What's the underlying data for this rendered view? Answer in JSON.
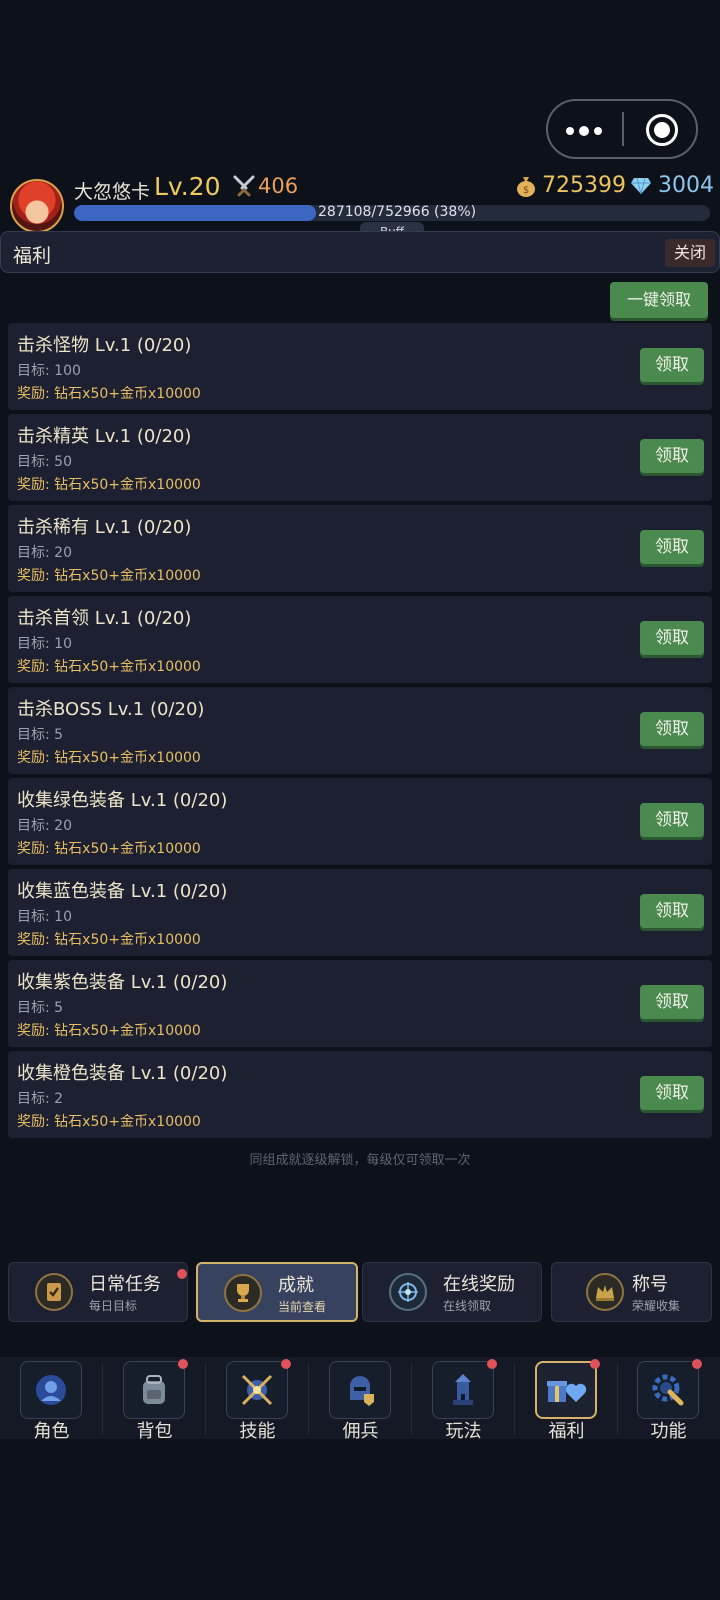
{
  "capsule": {
    "more_icon": "more-dots-icon",
    "record_icon": "record-icon"
  },
  "player": {
    "name": "大忽悠卡",
    "level": "Lv.20",
    "power": "406",
    "gold": "725399",
    "diamonds": "3004",
    "xp_text": "287108/752966 (38%)",
    "xp_progress": 0.38,
    "buff_label": "Buff"
  },
  "panel": {
    "title": "福利",
    "close_label": "关闭",
    "claim_all_label": "一键领取"
  },
  "tasks": [
    {
      "title": "击杀怪物 Lv.1 (0/20)",
      "target": "目标: 100",
      "reward": "奖励: 钻石x50+金币x10000",
      "button": "领取"
    },
    {
      "title": "击杀精英 Lv.1 (0/20)",
      "target": "目标: 50",
      "reward": "奖励: 钻石x50+金币x10000",
      "button": "领取"
    },
    {
      "title": "击杀稀有 Lv.1 (0/20)",
      "target": "目标: 20",
      "reward": "奖励: 钻石x50+金币x10000",
      "button": "领取"
    },
    {
      "title": "击杀首领 Lv.1 (0/20)",
      "target": "目标: 10",
      "reward": "奖励: 钻石x50+金币x10000",
      "button": "领取"
    },
    {
      "title": "击杀BOSS Lv.1 (0/20)",
      "target": "目标: 5",
      "reward": "奖励: 钻石x50+金币x10000",
      "button": "领取"
    },
    {
      "title": "收集绿色装备 Lv.1 (0/20)",
      "target": "目标: 20",
      "reward": "奖励: 钻石x50+金币x10000",
      "button": "领取"
    },
    {
      "title": "收集蓝色装备 Lv.1 (0/20)",
      "target": "目标: 10",
      "reward": "奖励: 钻石x50+金币x10000",
      "button": "领取"
    },
    {
      "title": "收集紫色装备 Lv.1 (0/20)",
      "target": "目标: 5",
      "reward": "奖励: 钻石x50+金币x10000",
      "button": "领取"
    },
    {
      "title": "收集橙色装备 Lv.1 (0/20)",
      "target": "目标: 2",
      "reward": "奖励: 钻石x50+金币x10000",
      "button": "领取"
    }
  ],
  "footnote": "同组成就逐级解锁，每级仅可领取一次",
  "subtabs": [
    {
      "label": "日常任务",
      "sub": "每日目标",
      "icon": "task-scroll-icon",
      "active": false,
      "badge": true
    },
    {
      "label": "成就",
      "sub": "当前查看",
      "icon": "trophy-icon",
      "active": true,
      "badge": false
    },
    {
      "label": "在线奖励",
      "sub": "在线领取",
      "icon": "online-reward-icon",
      "active": false,
      "badge": false
    },
    {
      "label": "称号",
      "sub": "荣耀收集",
      "icon": "crown-icon",
      "active": false,
      "badge": false
    }
  ],
  "nav": [
    {
      "label": "角色",
      "icon": "character-icon",
      "active": false,
      "badge": false
    },
    {
      "label": "背包",
      "icon": "backpack-icon",
      "active": false,
      "badge": true
    },
    {
      "label": "技能",
      "icon": "skill-icon",
      "active": false,
      "badge": true
    },
    {
      "label": "佣兵",
      "icon": "mercenary-helmet-icon",
      "active": false,
      "badge": false
    },
    {
      "label": "玩法",
      "icon": "gameplay-tower-icon",
      "active": false,
      "badge": true
    },
    {
      "label": "福利",
      "icon": "welfare-gift-icon",
      "active": true,
      "badge": true
    },
    {
      "label": "功能",
      "icon": "function-gear-icon",
      "active": false,
      "badge": true
    }
  ]
}
